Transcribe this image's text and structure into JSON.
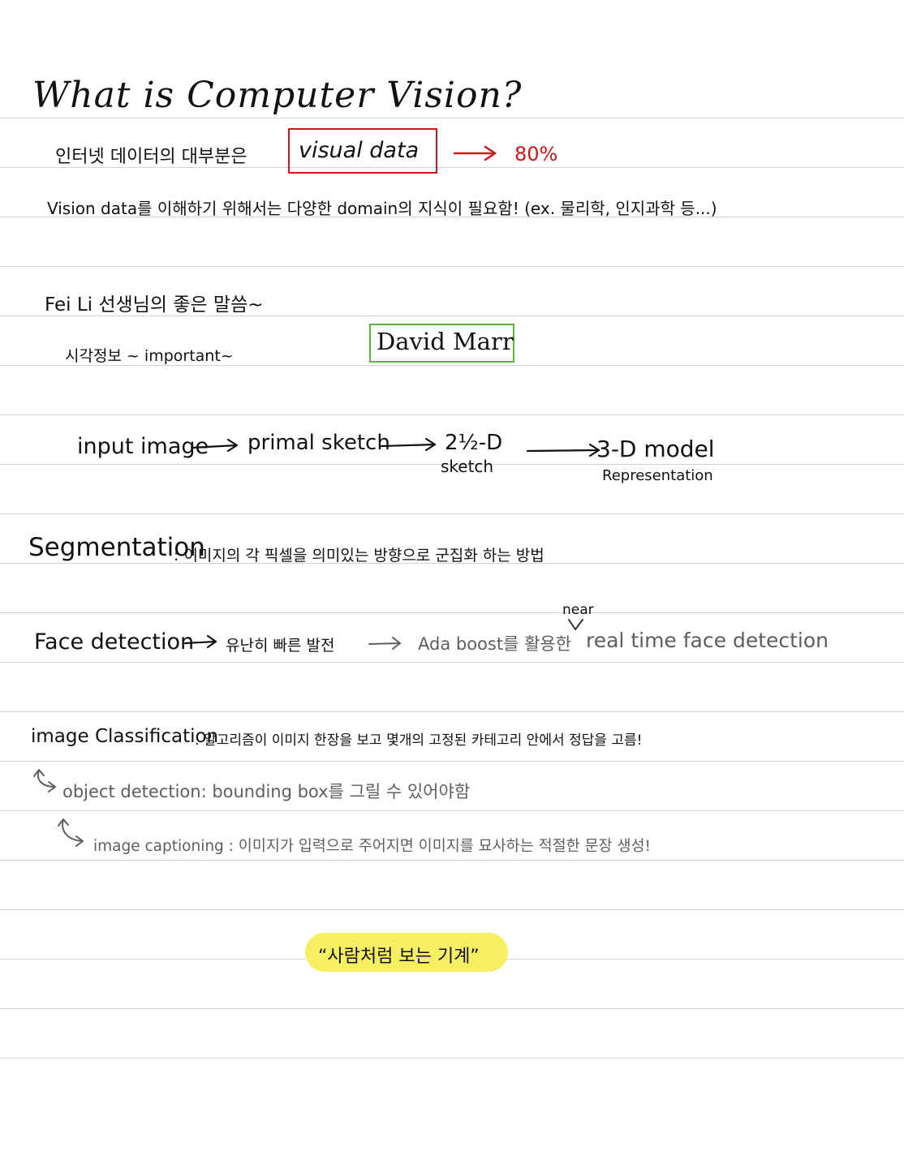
{
  "note": {
    "title": "What is Computer Vision?",
    "line1": {
      "prefix": "인터넷 데이터의 대부분은",
      "boxed": "visual data",
      "arrow_target": "80%"
    },
    "line2": "Vision data를 이해하기 위해서는 다양한 domain의 지식이 필요함! (ex. 물리학, 인지과학 등...)",
    "feili": {
      "heading": "Fei Li 선생님의 좋은 말씀~",
      "sub": "시각정보 ~ important~",
      "boxed_name": "David Marr"
    },
    "pipeline": {
      "steps": [
        "input image",
        "primal sketch",
        "2½-D",
        "3-D model"
      ],
      "notes": [
        "sketch",
        "Representation"
      ]
    },
    "segmentation": {
      "term": "Segmentation",
      "desc": ": 이미지의 각 픽셀을 의미있는 방향으로 군집화 하는 방법"
    },
    "face": {
      "term": "Face detection",
      "desc": "유난히 빠른 발전",
      "gray_part": "Ada boost를 활용한",
      "insert_word": "near",
      "gray_tail": "real time face detection"
    },
    "classification": {
      "term": "image Classification",
      "desc": ": 알고리즘이 이미지 한장을 보고 몇개의 고정된 카테고리 안에서 정답을 고름!",
      "sub1": "object detection: bounding box를 그릴 수 있어야함",
      "sub2": "image captioning : 이미지가 입력으로 주어지면 이미지를 묘사하는 적절한 문장 생성!"
    },
    "quote": "“사람처럼 보는 기계”"
  },
  "colors": {
    "ink": "#111111",
    "gray_ink": "#5e5e5e",
    "red": "#d0161c",
    "green": "#5cb43a",
    "highlight": "#f7ef62",
    "rule": "#d2d2d2"
  },
  "icons": [
    "arrow-right-icon",
    "caret-insert-icon",
    "curved-arrow-icon"
  ]
}
